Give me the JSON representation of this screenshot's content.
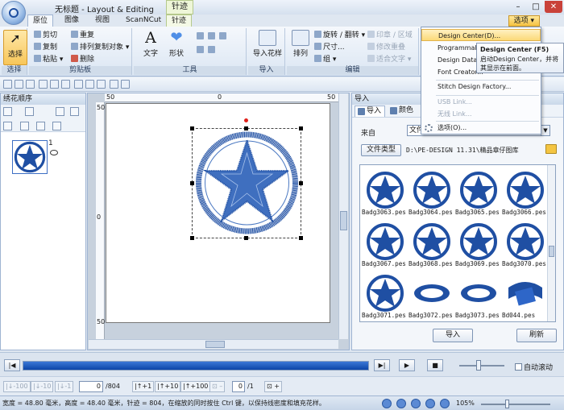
{
  "window": {
    "title": "无标题 - Layout & Editing",
    "context_tab_header": "针迹"
  },
  "tabs": [
    {
      "label": "原位",
      "active": true
    },
    {
      "label": "图像"
    },
    {
      "label": "视图"
    },
    {
      "label": "ScanNCut"
    },
    {
      "label": "针迹",
      "contextual": true
    }
  ],
  "options_button": "选项",
  "ribbon": {
    "select": {
      "label": "选择",
      "group": "选择"
    },
    "clipboard": {
      "group": "剪贴板",
      "cut": "剪切",
      "copy": "复制",
      "paste": "粘贴",
      "repeat": "重复",
      "array_copy": "排列复制对象",
      "delete": "删除"
    },
    "tools": {
      "group": "工具",
      "text": "文字",
      "shape": "形状"
    },
    "import": {
      "group": "导入",
      "import_pattern": "导入花样"
    },
    "edit": {
      "group": "编辑",
      "arrange": "排列",
      "rotate_flip": "旋转 / 翻转",
      "size": "尺寸...",
      "group_btn": "组",
      "stamp": "印章 / 区域",
      "modify_stitch": "修改重叠",
      "fit_text": "适合文字"
    }
  },
  "options_menu": {
    "items": [
      "Design Center(D)...",
      "Programmable Stitch Creator...",
      "Design Database...",
      "Font Creator...",
      "Stitch Design Factory...",
      "USB Link...",
      "无线 Link...",
      "选项(O)..."
    ],
    "tooltip_title": "Design Center (F5)",
    "tooltip_body": "启动Design Center，并将其显示在前面。"
  },
  "left_panel": {
    "title": "绣花顺序",
    "items": [
      {
        "index": "1"
      }
    ]
  },
  "canvas": {
    "ruler_h_labels": [
      "50",
      "0",
      "50"
    ],
    "ruler_v_labels": [
      "50",
      "0",
      "50"
    ]
  },
  "right_panel": {
    "title": "导入",
    "tabs": [
      "导入",
      "颜色"
    ],
    "from_label": "来自",
    "from_value": "文件",
    "file_type_button": "文件类型",
    "path": "D:\\PE-DESIGN 11.31\\精品章仔图库",
    "files": [
      "Badg3063.pes",
      "Badg3064.pes",
      "Badg3065.pes",
      "Badg3066.pes",
      "Badg3067.pes",
      "Badg3068.pes",
      "Badg3069.pes",
      "Badg3070.pes",
      "Badg3071.pes",
      "Badg3072.pes",
      "Badg3073.pes",
      "Bd044.pes"
    ],
    "import_button": "导入",
    "refresh_button": "刷新"
  },
  "playback": {
    "progress": 1.0,
    "auto_scroll": "自动滚动",
    "speed_level": 0.42
  },
  "stepbar": {
    "btn_m100": "-100",
    "btn_m10": "-10",
    "btn_m1": "-1",
    "current": "0",
    "total": "/804",
    "btn_p1": "+1",
    "btn_p10": "+10",
    "btn_p100": "+100",
    "color_current": "0",
    "color_total": "/1"
  },
  "status": {
    "text": "宽度 = 48.80 毫米，高度 = 48.40 毫米，针迹 = 804，在缩放的同时按住 Ctrl 键，以保持线密度和填充花样。",
    "zoom": "105%",
    "zoom_level": 0.38
  },
  "colors": {
    "stitch_blue": "#1f4fa3",
    "accent_orange": "#f5c241",
    "progress_blue": "#0c45a8"
  }
}
